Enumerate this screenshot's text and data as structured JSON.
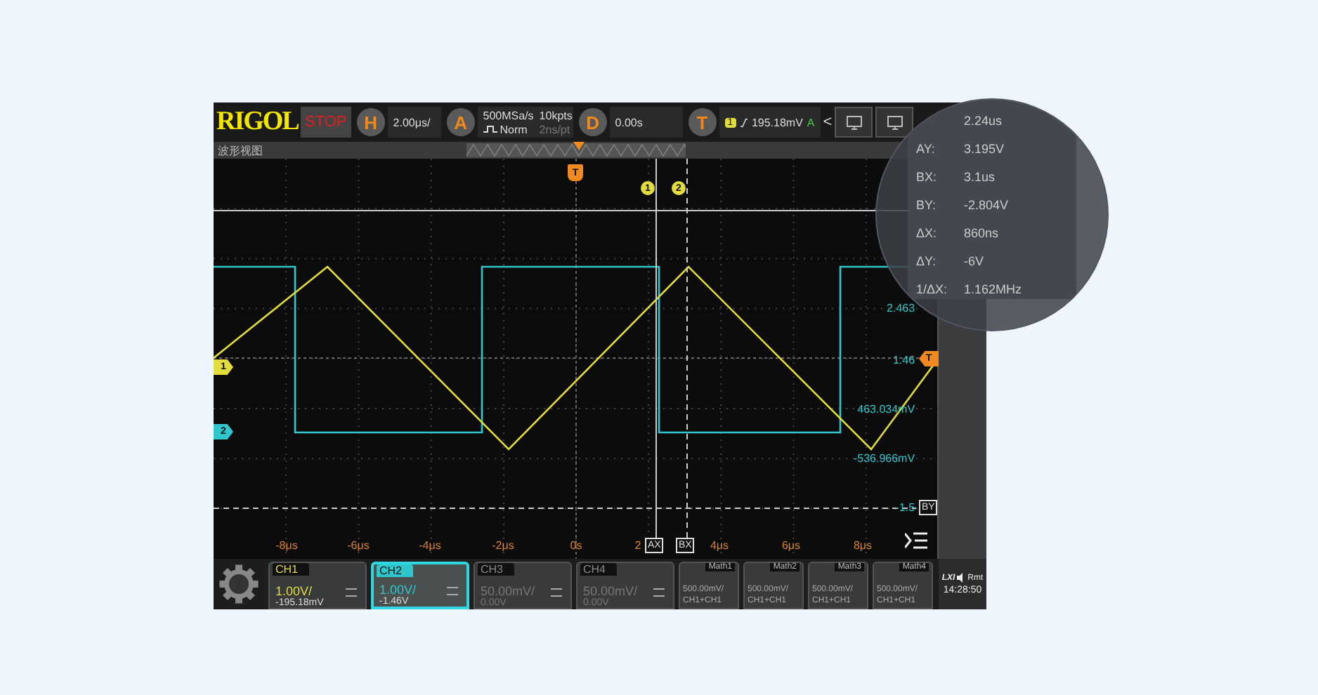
{
  "toolbar": {
    "logo": "RIGOL",
    "run_state": "STOP",
    "horizontal": {
      "key": "H",
      "value": "2.00μs/"
    },
    "acquire": {
      "key": "A",
      "sample_rate": "500MSa/s",
      "mode": "Norm",
      "memory_depth": "10kpts",
      "resolution": "2ns/pt"
    },
    "delay": {
      "key": "D",
      "value": "0.00s"
    },
    "trigger": {
      "key": "T",
      "source": "1",
      "level": "195.18mV",
      "status": "A"
    },
    "collapse": "<"
  },
  "view_title": "波形视图",
  "plot": {
    "trigger_marker": "T",
    "cursor_markers": [
      {
        "text": "1"
      },
      {
        "text": "2"
      }
    ],
    "channel_markers": [
      {
        "text": "1",
        "color": "#e2dc3c"
      },
      {
        "text": "2",
        "color": "#2fc6cc"
      }
    ],
    "y_labels": [
      "2.463",
      "1.46",
      "463.034mV",
      "-536.966mV",
      "-1.5"
    ],
    "x_labels": [
      "-8μs",
      "-6μs",
      "-4μs",
      "-2μs",
      "0s",
      "2",
      "4μs",
      "6μs",
      "8μs"
    ],
    "cursor_labels": [
      "AX",
      "BX",
      "BY"
    ],
    "level_marker": "T"
  },
  "channels": [
    {
      "name": "CH1",
      "scale": "1.00V/",
      "offset": "-195.18mV",
      "selected": false,
      "enabled": true,
      "color": "#e2dc3c"
    },
    {
      "name": "CH2",
      "scale": "1.00V/",
      "offset": "-1.46V",
      "selected": true,
      "enabled": true,
      "color": "#2fc6cc"
    },
    {
      "name": "CH3",
      "scale": "50.00mV/",
      "offset": "0.00V",
      "selected": false,
      "enabled": false
    },
    {
      "name": "CH4",
      "scale": "50.00mV/",
      "offset": "0.00V",
      "selected": false,
      "enabled": false
    }
  ],
  "math": [
    {
      "name": "Math1",
      "scale": "500.00mV/",
      "source": "CH1+CH1"
    },
    {
      "name": "Math2",
      "scale": "500.00mV/",
      "source": "CH1+CH1"
    },
    {
      "name": "Math3",
      "scale": "500.00mV/",
      "source": "CH1+CH1"
    },
    {
      "name": "Math4",
      "scale": "500.00mV/",
      "source": "CH1+CH1"
    }
  ],
  "status": {
    "lxi": "LXI",
    "remote": "Rmt",
    "time": "14:28:50"
  },
  "magnifier": {
    "rows": [
      {
        "value": "2.24us"
      },
      {
        "label": "AY:",
        "value": "3.195V"
      },
      {
        "label": "BX:",
        "value": "3.1us"
      },
      {
        "label": "BY:",
        "value": "-2.804V"
      },
      {
        "label": "ΔX:",
        "value": "860ns"
      },
      {
        "label": "ΔY:",
        "value": "-6V"
      },
      {
        "label": "1/ΔX:",
        "value": "1.162MHz"
      }
    ]
  }
}
